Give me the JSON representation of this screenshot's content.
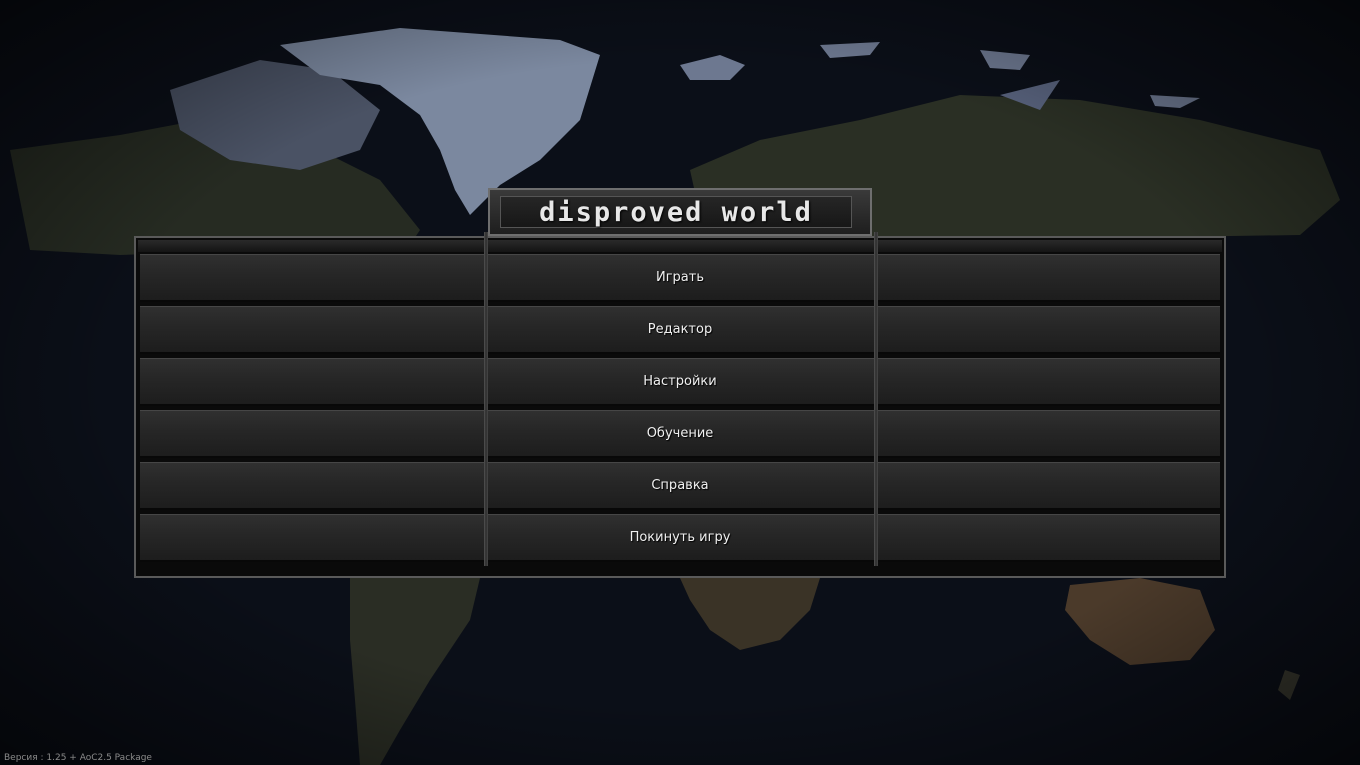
{
  "game": {
    "title": "disproved world",
    "version": "Версия : 1.25 + AoC2.5 Package"
  },
  "menu": {
    "items": [
      {
        "label": "Играть"
      },
      {
        "label": "Редактор"
      },
      {
        "label": "Настройки"
      },
      {
        "label": "Обучение"
      },
      {
        "label": "Справка"
      },
      {
        "label": "Покинуть игру"
      }
    ]
  },
  "colors": {
    "ocean": "#0b0f18",
    "land": "#2a2e24",
    "ice": "#6f7d93",
    "panel": "#272727",
    "border": "#5a5a5a",
    "text": "#f0f0f0"
  }
}
